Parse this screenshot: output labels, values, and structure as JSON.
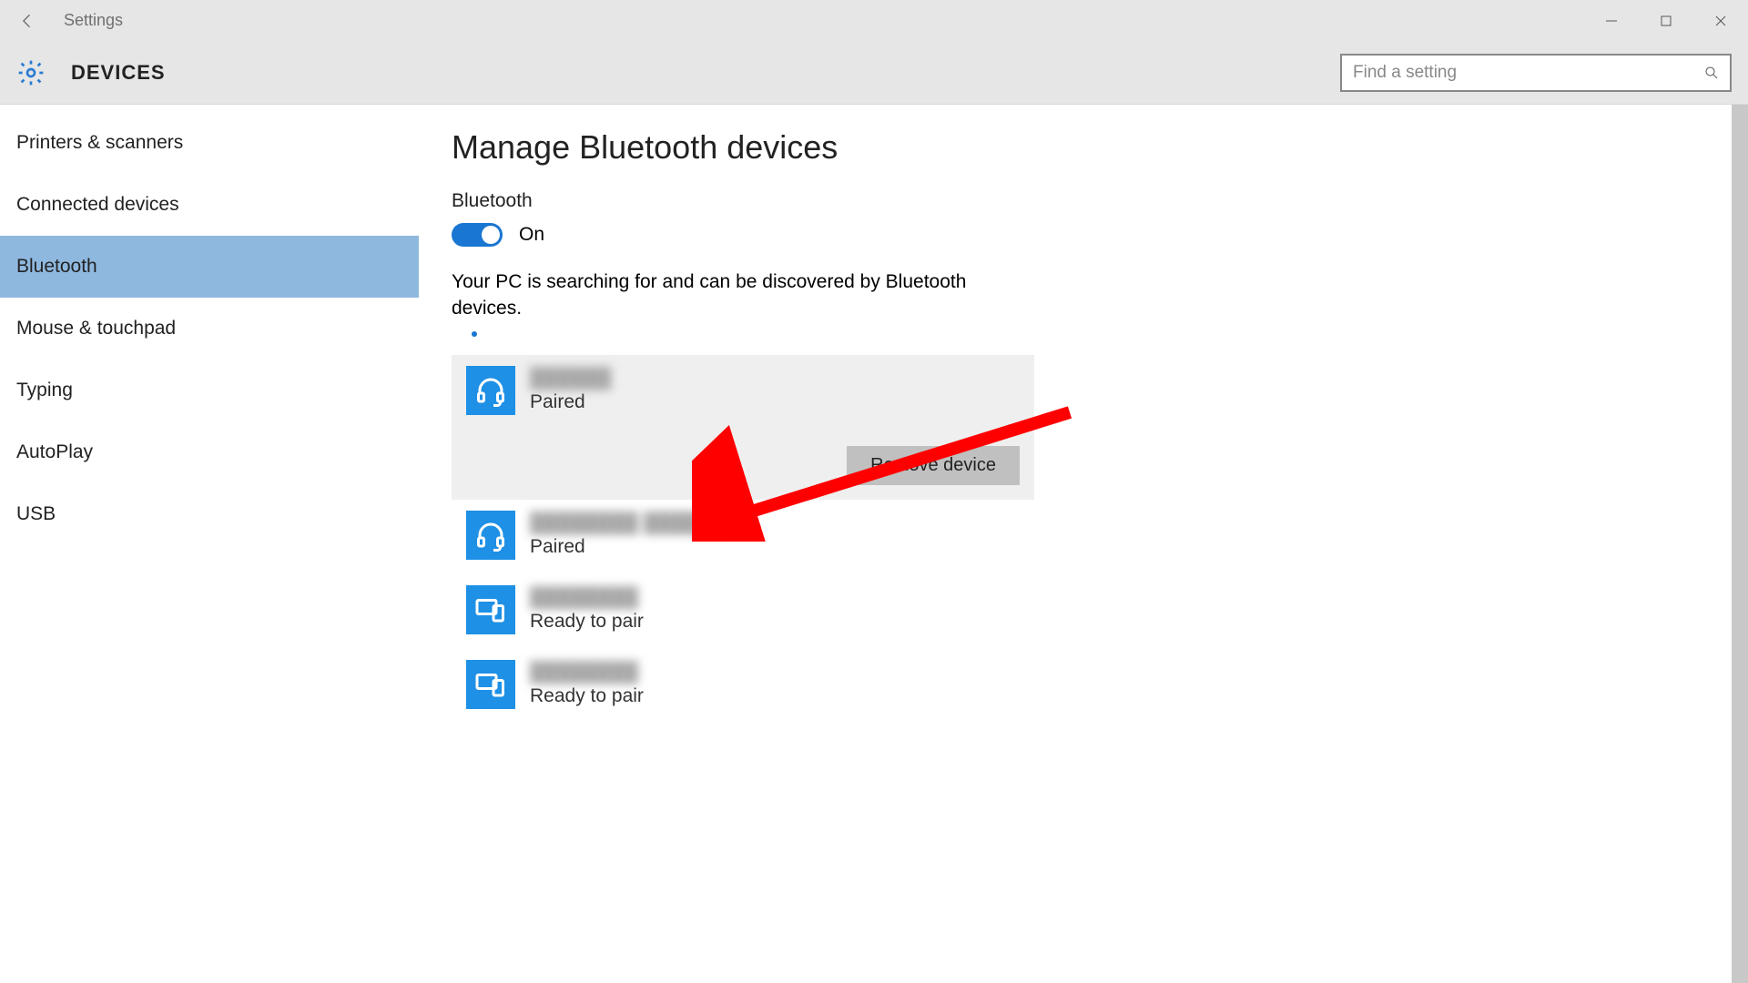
{
  "window": {
    "title": "Settings"
  },
  "header": {
    "section": "DEVICES",
    "search_placeholder": "Find a setting"
  },
  "sidebar": {
    "items": [
      {
        "label": "Printers & scanners"
      },
      {
        "label": "Connected devices"
      },
      {
        "label": "Bluetooth"
      },
      {
        "label": "Mouse & touchpad"
      },
      {
        "label": "Typing"
      },
      {
        "label": "AutoPlay"
      },
      {
        "label": "USB"
      }
    ],
    "selected_index": 2
  },
  "main": {
    "heading": "Manage Bluetooth devices",
    "toggle_label": "Bluetooth",
    "toggle_state_text": "On",
    "status_text": "Your PC is searching for and can be discovered by Bluetooth devices.",
    "remove_button": "Remove device"
  },
  "devices": [
    {
      "name": "██████",
      "status": "Paired",
      "icon": "headset",
      "selected": true
    },
    {
      "name": "████████ ███████",
      "status": "Paired",
      "icon": "headset",
      "selected": false
    },
    {
      "name": "████████",
      "status": "Ready to pair",
      "icon": "devices",
      "selected": false
    },
    {
      "name": "████████",
      "status": "Ready to pair",
      "icon": "devices",
      "selected": false
    }
  ]
}
